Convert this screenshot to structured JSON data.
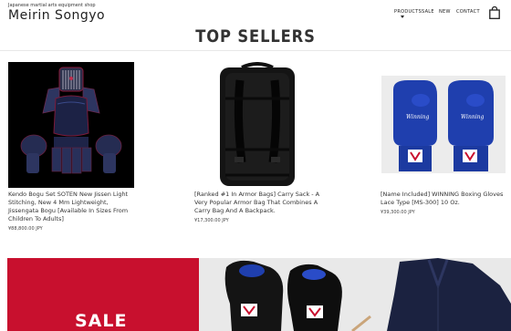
{
  "store": {
    "tagline": "Japanese martial arts equipment shop",
    "name": "Meirin Songyo"
  },
  "nav": {
    "items": [
      "PRODUCTS",
      "SALE",
      "NEW",
      "CONTACT"
    ]
  },
  "icons": {
    "cart": "shopping-bag-icon",
    "dropdown": "caret-down-icon"
  },
  "section": {
    "heading": "TOP SELLERS"
  },
  "products": [
    {
      "title": "Kendo Bogu Set SOTEN New Jissen Light Stitching, New 4 Mm Lightweight, Jissengata Bogu [Available In Sizes From Children To Adults]",
      "price": "¥88,800.00 JPY"
    },
    {
      "title": "[Ranked #1 In Armor Bags] Carry Sack - A Very Popular Armor Bag That Combines A Carry Bag And A Backpack.",
      "price": "¥17,300.00 JPY"
    },
    {
      "title": "[Name Included] WINNING Boxing Gloves Lace Type [MS-300] 10 Oz.",
      "price": "¥39,300.00 JPY"
    }
  ],
  "banner": {
    "label": "SALE",
    "color": "#c8102e"
  },
  "colors": {
    "accent_red": "#c8102e",
    "glove_blue": "#1f3fae"
  }
}
